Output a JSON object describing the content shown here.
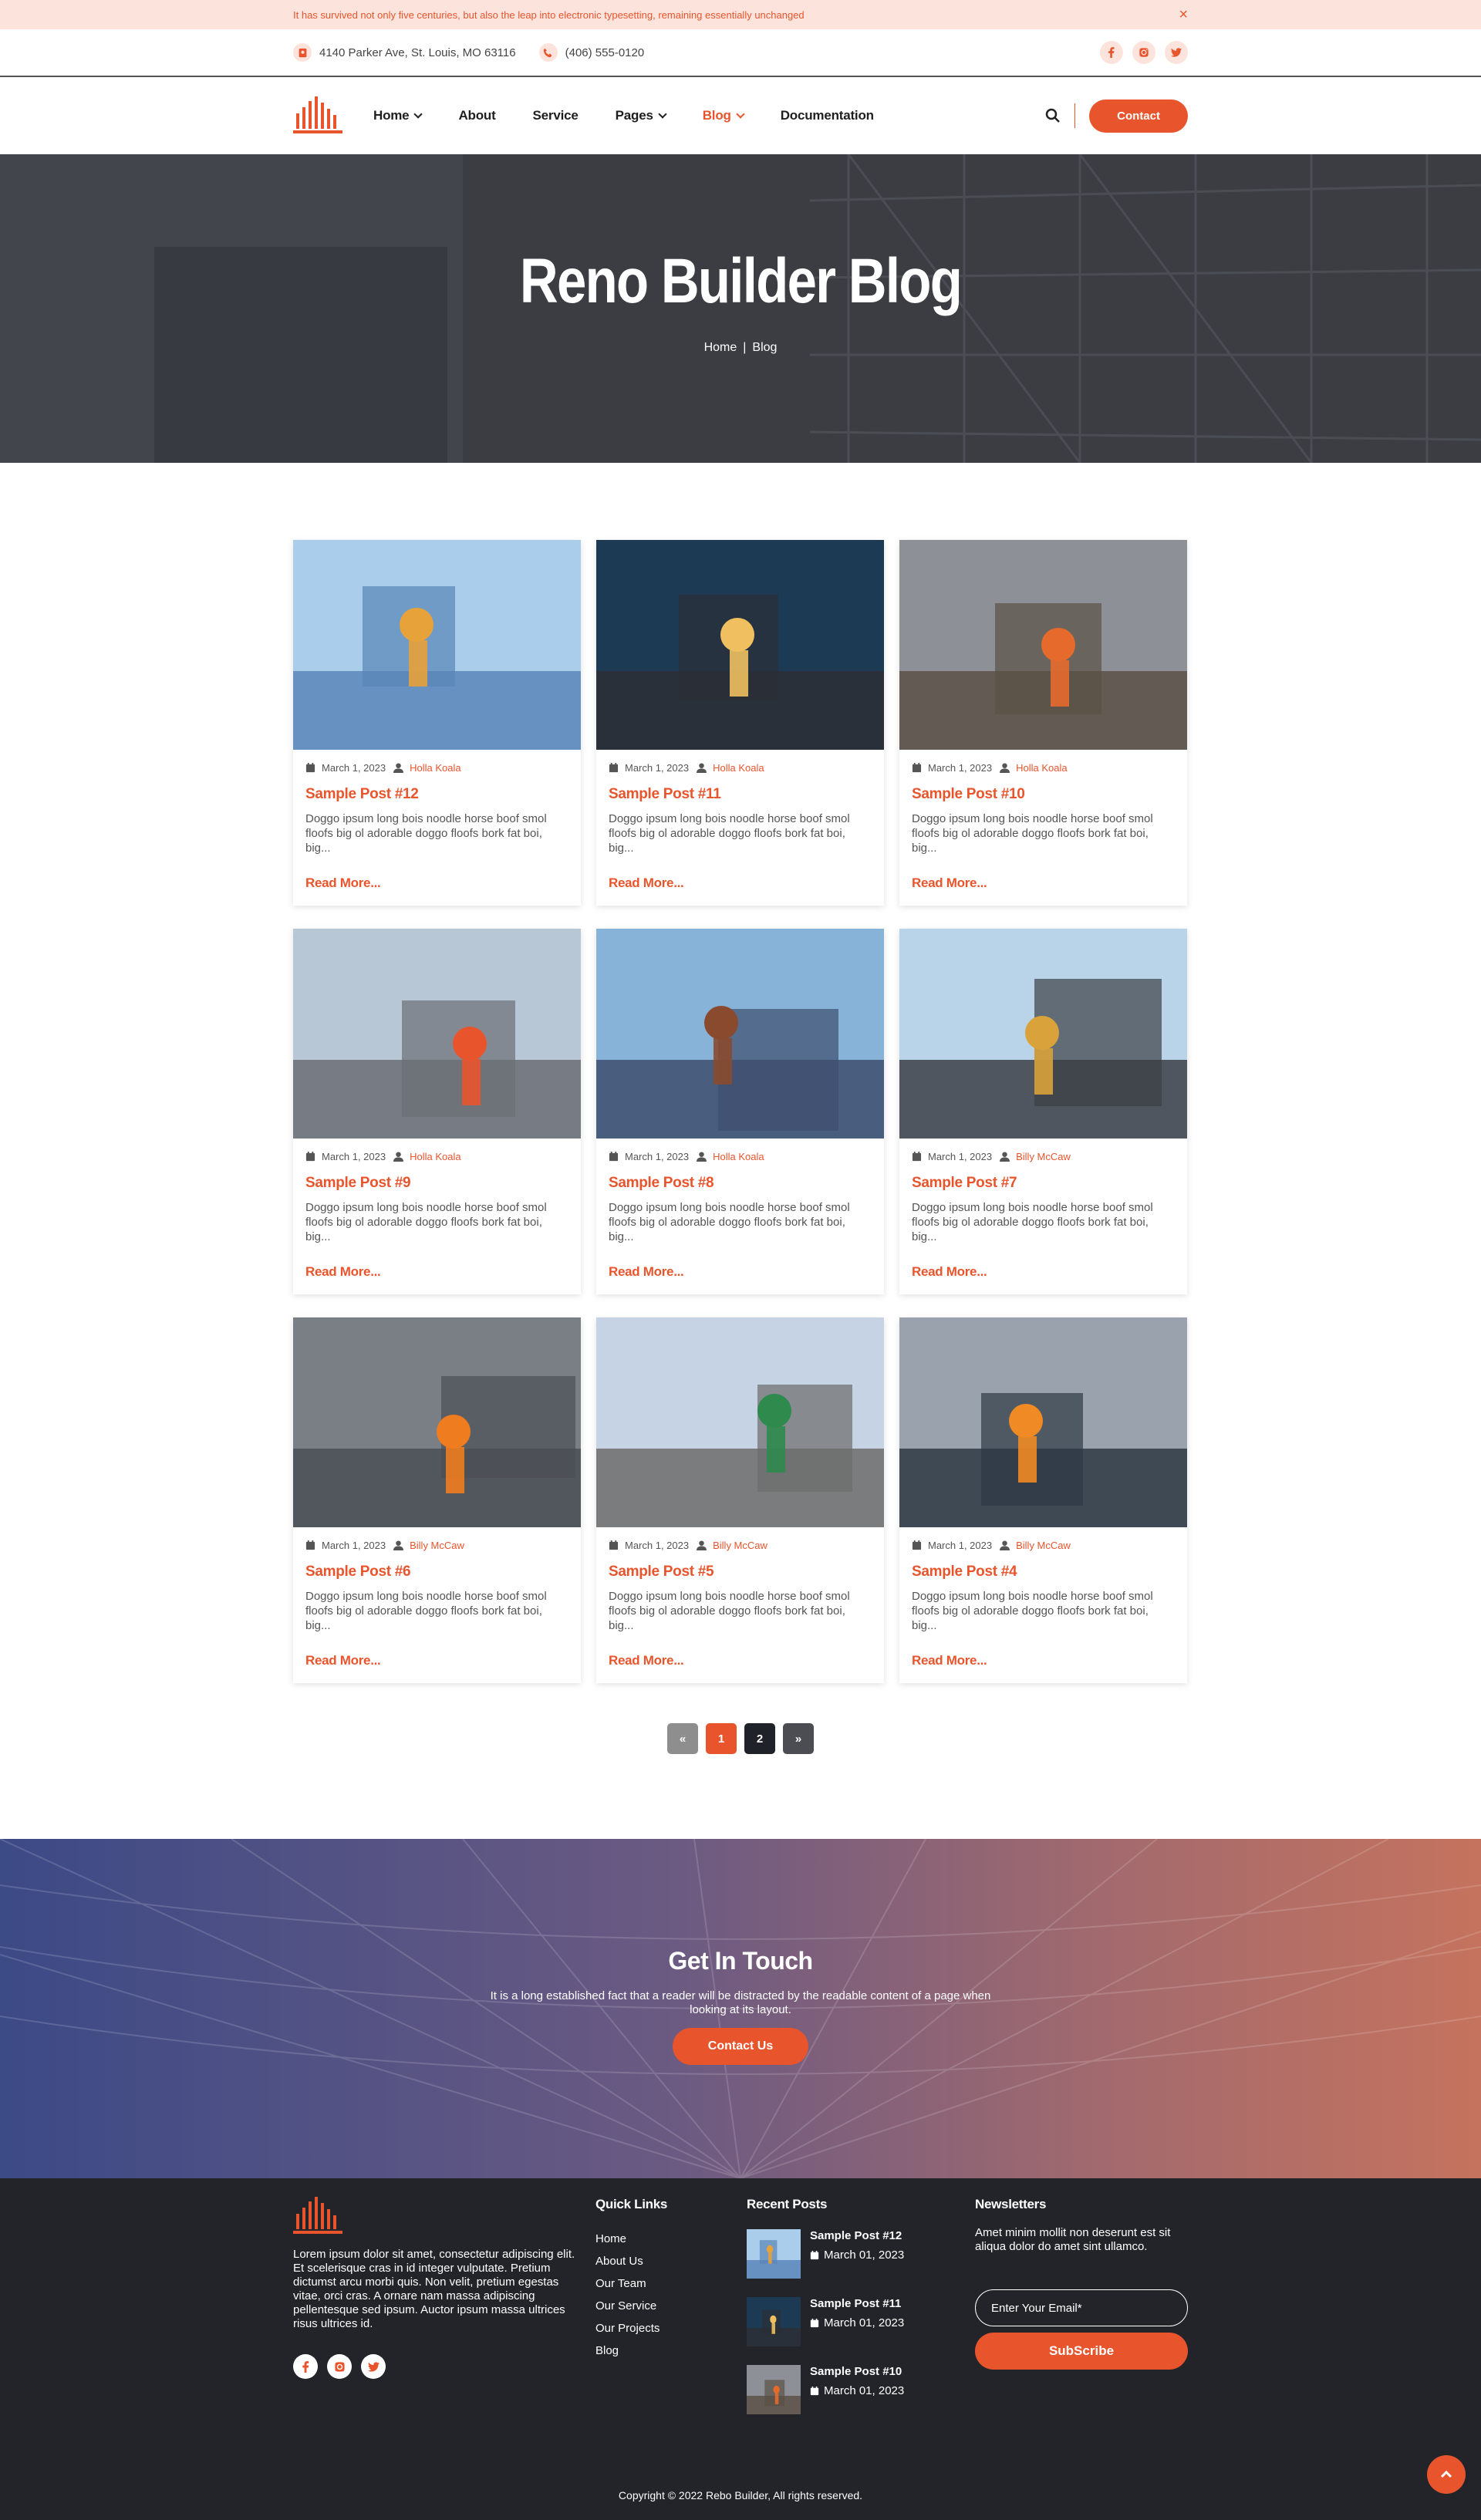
{
  "announcement": {
    "text": "It has survived not only five centuries, but also the leap into electronic typesetting, remaining essentially unchanged",
    "close": "×"
  },
  "info": {
    "address": "4140 Parker Ave, St. Louis, MO 63116",
    "phone": "(406) 555-0120"
  },
  "nav": {
    "items": [
      {
        "label": "Home",
        "dropdown": true
      },
      {
        "label": "About"
      },
      {
        "label": "Service"
      },
      {
        "label": "Pages",
        "dropdown": true
      },
      {
        "label": "Blog",
        "dropdown": true,
        "active": true
      },
      {
        "label": "Documentation"
      }
    ],
    "contact_label": "Contact"
  },
  "hero": {
    "title": "Reno Builder Blog",
    "crumb_home": "Home",
    "crumb_sep": "|",
    "crumb_current": "Blog"
  },
  "posts": [
    {
      "date": "March 1, 2023",
      "author": "Holla Koala",
      "title": "Sample Post #12",
      "excerpt": "Doggo ipsum long bois noodle horse boof smol floofs big ol adorable doggo floofs bork fat boi, big...",
      "read_more": "Read More..."
    },
    {
      "date": "March 1, 2023",
      "author": "Holla Koala",
      "title": "Sample Post #11",
      "excerpt": "Doggo ipsum long bois noodle horse boof smol floofs big ol adorable doggo floofs bork fat boi, big...",
      "read_more": "Read More..."
    },
    {
      "date": "March 1, 2023",
      "author": "Holla Koala",
      "title": "Sample Post #10",
      "excerpt": "Doggo ipsum long bois noodle horse boof smol floofs big ol adorable doggo floofs bork fat boi, big...",
      "read_more": "Read More..."
    },
    {
      "date": "March 1, 2023",
      "author": "Holla Koala",
      "title": "Sample Post #9",
      "excerpt": "Doggo ipsum long bois noodle horse boof smol floofs big ol adorable doggo floofs bork fat boi, big...",
      "read_more": "Read More..."
    },
    {
      "date": "March 1, 2023",
      "author": "Holla Koala",
      "title": "Sample Post #8",
      "excerpt": "Doggo ipsum long bois noodle horse boof smol floofs big ol adorable doggo floofs bork fat boi, big...",
      "read_more": "Read More..."
    },
    {
      "date": "March 1, 2023",
      "author": "Billy McCaw",
      "title": "Sample Post #7",
      "excerpt": "Doggo ipsum long bois noodle horse boof smol floofs big ol adorable doggo floofs bork fat boi, big...",
      "read_more": "Read More..."
    },
    {
      "date": "March 1, 2023",
      "author": "Billy McCaw",
      "title": "Sample Post #6",
      "excerpt": "Doggo ipsum long bois noodle horse boof smol floofs big ol adorable doggo floofs bork fat boi, big...",
      "read_more": "Read More..."
    },
    {
      "date": "March 1, 2023",
      "author": "Billy McCaw",
      "title": "Sample Post #5",
      "excerpt": "Doggo ipsum long bois noodle horse boof smol floofs big ol adorable doggo floofs bork fat boi, big...",
      "read_more": "Read More..."
    },
    {
      "date": "March 1, 2023",
      "author": "Billy McCaw",
      "title": "Sample Post #4",
      "excerpt": "Doggo ipsum long bois noodle horse boof smol floofs big ol adorable doggo floofs bork fat boi, big...",
      "read_more": "Read More..."
    }
  ],
  "pagination": {
    "pages": [
      "1",
      "2"
    ],
    "current": "1"
  },
  "cta": {
    "title": "Get In Touch",
    "text": "It is a long established fact that a reader will be distracted by the readable content of a page when looking at its layout.",
    "button": "Contact Us"
  },
  "footer": {
    "about": "Lorem ipsum dolor sit amet, consectetur adipiscing elit. Et scelerisque cras in id integer vulputate. Pretium dictumst arcu morbi quis. Non velit, pretium egestas vitae, orci cras. A ornare nam massa adipiscing pellentesque sed ipsum. Auctor ipsum massa ultrices risus ultrices id.",
    "quick_links_title": "Quick Links",
    "quick_links": [
      "Home",
      "About Us",
      "Our Team",
      "Our Service",
      "Our Projects",
      "Blog"
    ],
    "recent_title": "Recent Posts",
    "recent": [
      {
        "title": "Sample Post #12",
        "date": "March 01, 2023"
      },
      {
        "title": "Sample Post #11",
        "date": "March 01, 2023"
      },
      {
        "title": "Sample Post #10",
        "date": "March 01, 2023"
      }
    ],
    "news_title": "Newsletters",
    "news_text": "Amet minim mollit non deserunt est sit aliqua dolor do amet sint ullamco.",
    "news_placeholder": "Enter Your Email*",
    "news_button": "SubScribe",
    "copyright": "Copyright © 2022 Rebo Builder, All rights reserved."
  },
  "colors": {
    "accent": "#e8552d",
    "dark": "#222429",
    "announce_bg": "#fce4dc"
  }
}
